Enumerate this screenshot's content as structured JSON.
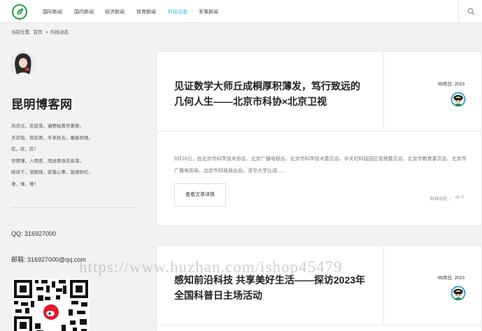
{
  "nav": {
    "items": [
      "国际新闻",
      "国内新闻",
      "经济新闻",
      "体育新闻",
      "科技动态",
      "军事新闻"
    ],
    "active_index": 4
  },
  "breadcrumb": {
    "label": "当前位置:",
    "home": "首页",
    "separator": ">",
    "current": "科技动态"
  },
  "sidebar": {
    "site_title": "昆明博客网",
    "poem": [
      "风亦过，花欲落，遍野枯黄尽萧索。",
      "天亦短，夜愈寒，冬来秋去，暖春尚晚。",
      "叹，叹，叹！",
      "世情薄，人情恶，雨送黄昏花易落。",
      "晓风干，泪痕残，欲笺心事，独语斜栏。",
      "难，难，难！"
    ],
    "qq": "QQ:  316927000",
    "email": "邮箱:  316927000@qq.com"
  },
  "posts": [
    {
      "title": "见证数学大师丘成桐厚积薄发，笃行致远的几何人生——北京市科协×北京卫视",
      "date": "09月日, 2023",
      "excerpt": "9月16日，由北京市科学技术协会、北京广播电视台、北京市科学技术委员会、中关村科技园区管理委员会、北京市教育委员会、北京市广播电视局、北京市财政局出品，清华大学丘成......",
      "read_more": "查看文章详情",
      "category": "科技动态",
      "views": "0"
    },
    {
      "title": "感知前沿科技 共享美好生活——探访2023年全国科普日主场活动",
      "date": "09月日, 2023"
    }
  ],
  "watermark": "https://www.huzhan.com/ishop45479",
  "icons": {
    "logo": "leaf-logo-icon",
    "search": "search-icon",
    "views": "eye-icon",
    "author": "author-avatar-icon"
  },
  "colors": {
    "accent": "#2fb6e3",
    "logo_green": "#1a9b3c",
    "background": "#f2f2f2"
  }
}
